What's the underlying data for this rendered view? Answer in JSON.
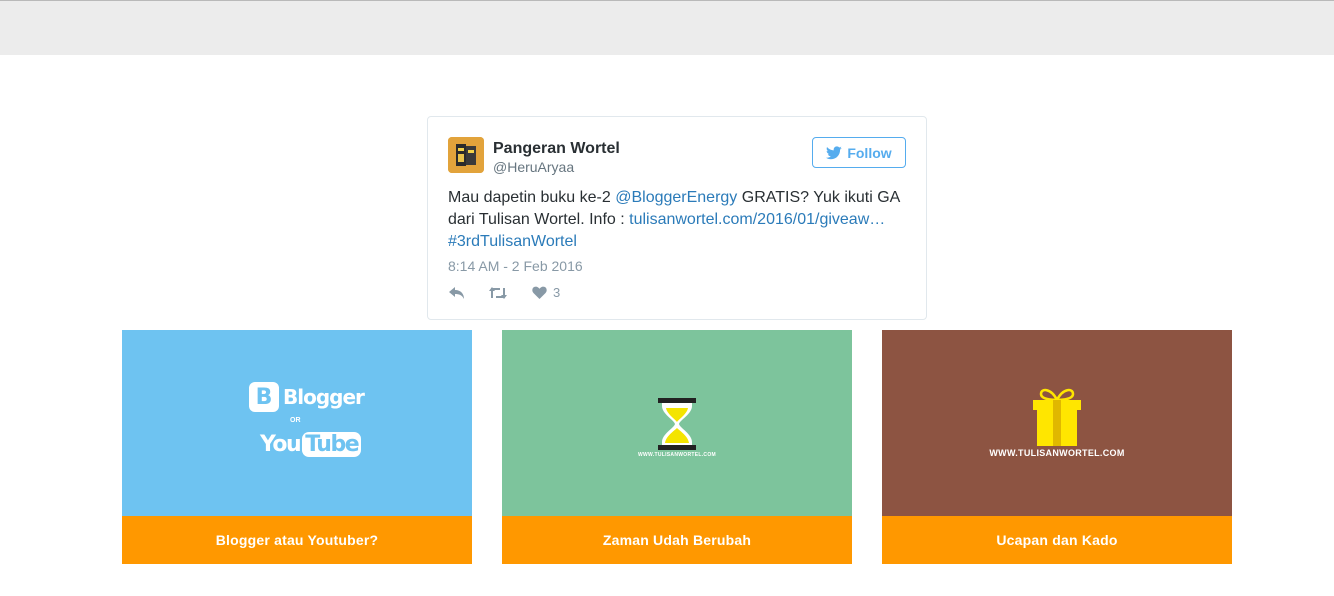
{
  "tweet": {
    "author_name": "Pangeran Wortel",
    "author_handle": "@HeruAryaa",
    "follow_label": "Follow",
    "text_parts": {
      "t1": "Mau dapetin buku ke-2 ",
      "mention": "@BloggerEnergy",
      "t2": " GRATIS? Yuk ikuti GA dari Tulisan Wortel. Info : ",
      "link": "tulisanwortel.com/2016/01/giveaw…",
      "hashtag": "#3rdTulisanWortel"
    },
    "timestamp": "8:14 AM - 2 Feb 2016",
    "like_count": "3",
    "colors": {
      "twitter_blue": "#55acee",
      "link_blue": "#2b7bb9"
    }
  },
  "cards": [
    {
      "caption": "Blogger atau Youtuber?",
      "thumb_color": "#6ec3f1",
      "logo_blogger_letter": "B",
      "logo_blogger_text": "Blogger",
      "logo_or": "OR",
      "logo_you": "You",
      "logo_tube": "Tube"
    },
    {
      "caption": "Zaman Udah Berubah",
      "thumb_color": "#7dc49c",
      "small_text": "WWW.TULISANWORTEL.COM"
    },
    {
      "caption": "Ucapan dan Kado",
      "thumb_color": "#8d5442",
      "small_text": "WWW.TULISANWORTEL.COM"
    }
  ],
  "caption_color": "#ff9800"
}
